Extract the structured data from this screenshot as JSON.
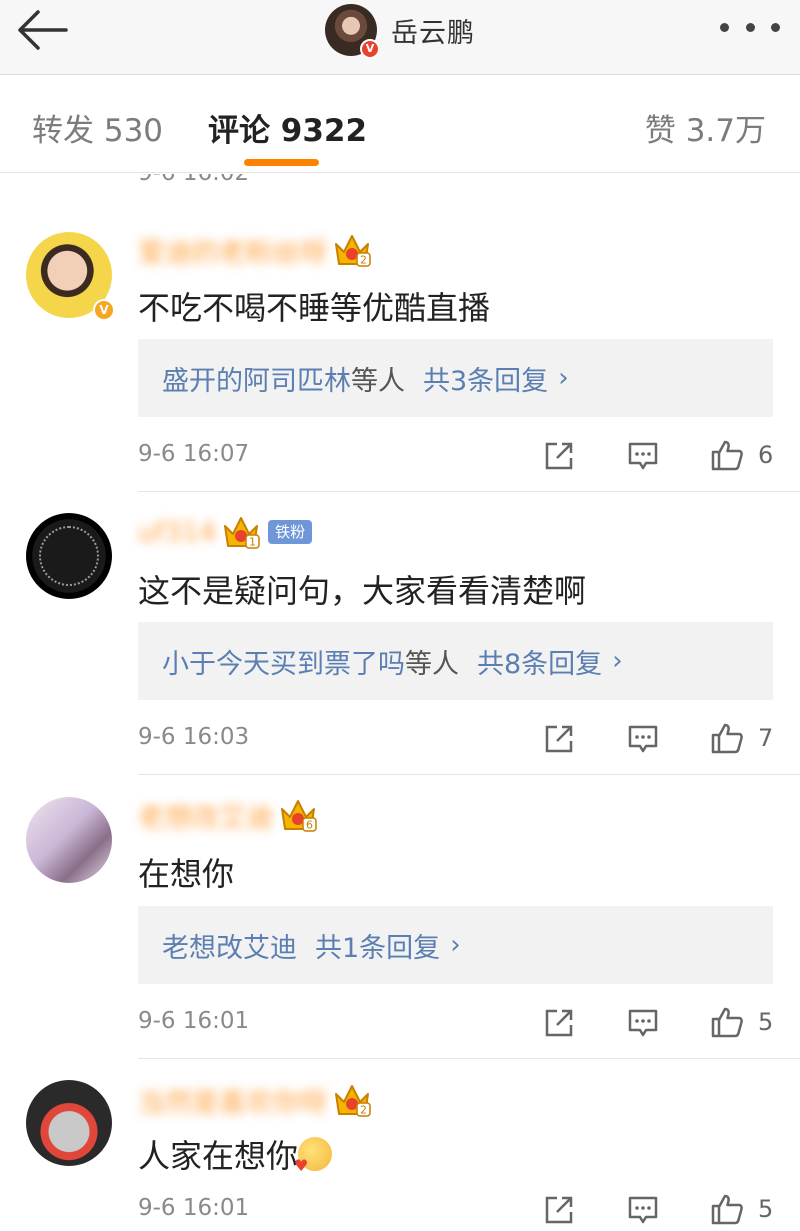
{
  "header": {
    "title": "岳云鹏",
    "avatar_badge": "V"
  },
  "tabs": {
    "repost": "转发 530",
    "comments": "评论 9322",
    "likes": "赞 3.7万",
    "active_color": "#ff8200"
  },
  "partial_time": "9-6 16:02",
  "comments": [
    {
      "crown_level": "2",
      "text": "不吃不喝不睡等优酷直播",
      "verified": "V",
      "replies": {
        "names": "盛开的阿司匹林",
        "suffix": "等人",
        "count": "共3条回复",
        "chevron": "›"
      },
      "time": "9-6 16:07",
      "likes": "6"
    },
    {
      "crown_level": "1",
      "fan_badge": "铁粉",
      "text": "这不是疑问句，大家看看清楚啊",
      "replies": {
        "names": "小于今天买到票了吗",
        "suffix": "等人",
        "count": "共8条回复",
        "chevron": "›"
      },
      "time": "9-6 16:03",
      "likes": "7"
    },
    {
      "crown_level": "6",
      "text": "在想你",
      "replies": {
        "names": "老想改艾迪",
        "suffix": "",
        "count": "共1条回复",
        "chevron": "›"
      },
      "time": "9-6 16:01",
      "likes": "5"
    },
    {
      "crown_level": "2",
      "text": "人家在想你",
      "time": "9-6 16:01",
      "likes": "5"
    }
  ],
  "colors": {
    "accent": "#ff8200",
    "link": "#5b7fb2",
    "verified": "#f5a623"
  }
}
